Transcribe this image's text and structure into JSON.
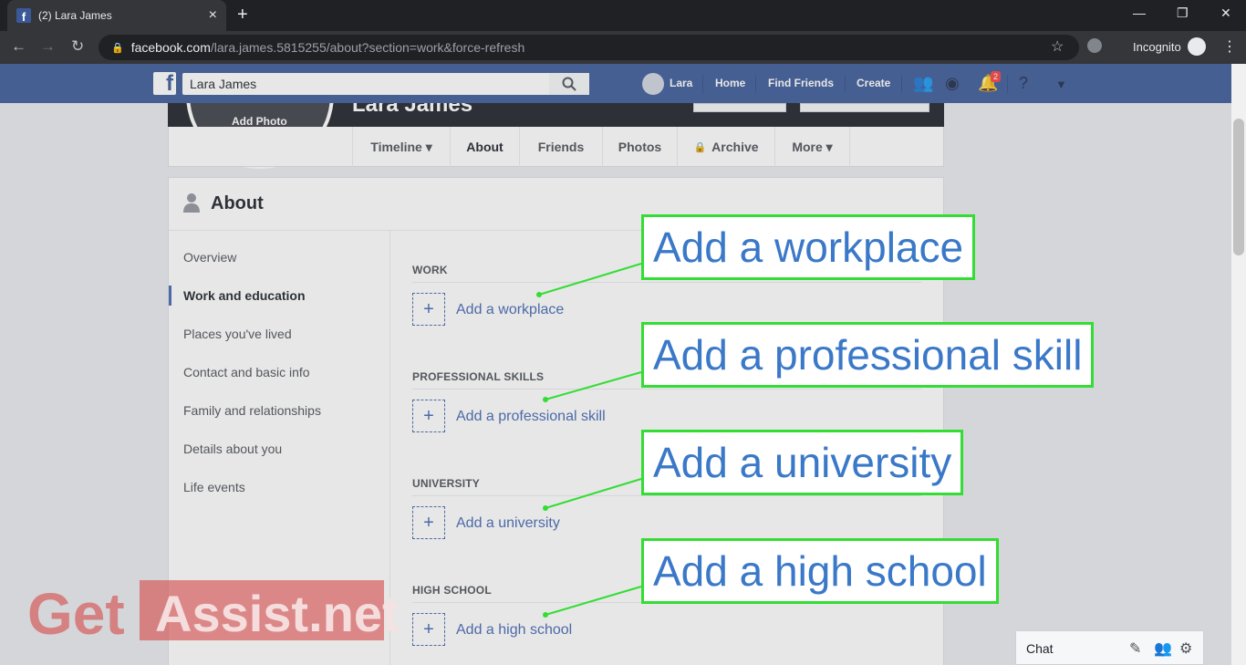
{
  "browser": {
    "tab_title": "(2) Lara James",
    "url_host": "facebook.com",
    "url_path": "/lara.james.5815255/about?section=work&force-refresh",
    "incognito_label": "Incognito"
  },
  "fb_header": {
    "search_value": "Lara James",
    "user_name": "Lara",
    "nav": [
      "Home",
      "Find Friends",
      "Create"
    ],
    "notification_count": "2"
  },
  "profile": {
    "name": "Lara James",
    "add_photo": "Add Photo",
    "tabs": [
      "Timeline ▾",
      "About",
      "Friends",
      "Photos",
      "Archive",
      "More ▾"
    ]
  },
  "about": {
    "title": "About",
    "sidebar": [
      "Overview",
      "Work and education",
      "Places you've lived",
      "Contact and basic info",
      "Family and relationships",
      "Details about you",
      "Life events"
    ],
    "sections": [
      {
        "header": "WORK",
        "link": "Add a workplace"
      },
      {
        "header": "PROFESSIONAL SKILLS",
        "link": "Add a professional skill"
      },
      {
        "header": "UNIVERSITY",
        "link": "Add a university"
      },
      {
        "header": "HIGH SCHOOL",
        "link": "Add a high school"
      }
    ]
  },
  "callouts": [
    "Add a workplace",
    "Add a professional skill",
    "Add a university",
    "Add a high school"
  ],
  "watermark": {
    "left": "Get",
    "right": "Assist.net"
  },
  "chat": {
    "label": "Chat"
  },
  "colors": {
    "fb_blue": "#3b5998",
    "callout_border": "#33dd33",
    "callout_text": "#3a78c8",
    "link": "#4267b2"
  }
}
